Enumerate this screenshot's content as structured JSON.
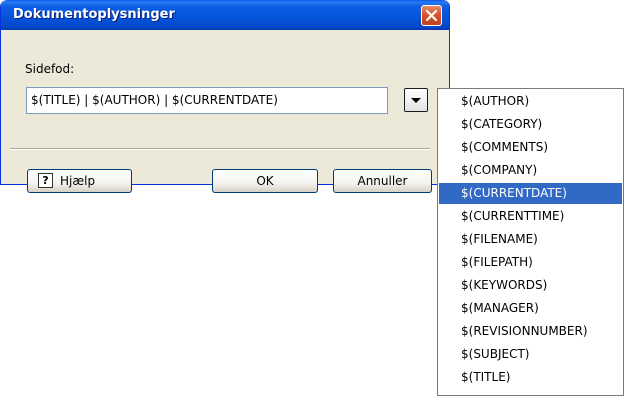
{
  "dialog": {
    "title": "Dokumentoplysninger",
    "field_label": "Sidefod:",
    "field_value": "$(TITLE) | $(AUTHOR) | $(CURRENTDATE)",
    "buttons": {
      "help": "Hjælp",
      "ok": "OK",
      "cancel": "Annuller"
    }
  },
  "dropdown": {
    "selected_index": 4,
    "items": [
      "$(AUTHOR)",
      "$(CATEGORY)",
      "$(COMMENTS)",
      "$(COMPANY)",
      "$(CURRENTDATE)",
      "$(CURRENTTIME)",
      "$(FILENAME)",
      "$(FILEPATH)",
      "$(KEYWORDS)",
      "$(MANAGER)",
      "$(REVISIONNUMBER)",
      "$(SUBJECT)",
      "$(TITLE)"
    ]
  },
  "icons": {
    "close": "close-icon",
    "help": "help-icon",
    "dropdown": "chevron-down-icon"
  },
  "colors": {
    "titlebar": "#0553da",
    "window_bg": "#ece9d8",
    "selection": "#316ac5"
  }
}
